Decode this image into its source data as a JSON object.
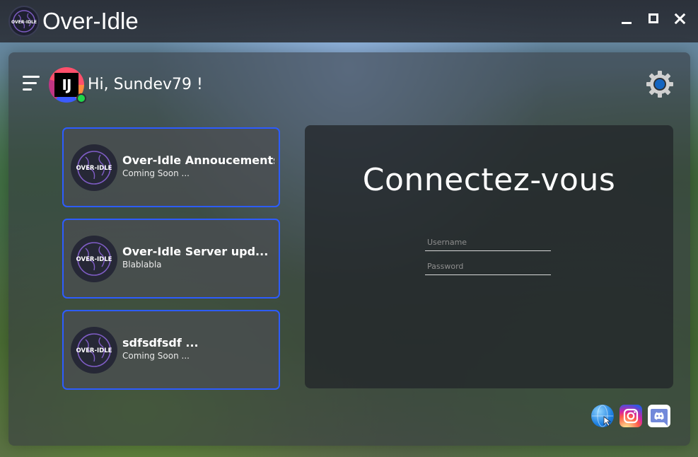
{
  "app": {
    "title": "Over-Idle",
    "logo_text": "OVER-IDLE"
  },
  "window_controls": {
    "minimize": "minimize",
    "maximize": "maximize",
    "close": "close"
  },
  "user": {
    "initials": "IJ",
    "greeting": "Hi, Sundev79 !",
    "status": "online"
  },
  "news": [
    {
      "title": "Over-Idle Annoucements",
      "subtitle": "Coming Soon ..."
    },
    {
      "title": "Over-Idle Server upd...",
      "subtitle": "Blablabla"
    },
    {
      "title": "sdfsdfsdf ...",
      "subtitle": "Coming Soon ..."
    }
  ],
  "login": {
    "title": "Connectez-vous",
    "username_placeholder": "Username",
    "password_placeholder": "Password",
    "username_value": "",
    "password_value": ""
  },
  "social": [
    "globe-icon",
    "instagram-icon",
    "discord-icon"
  ],
  "colors": {
    "accent": "#2d5cff",
    "status_online": "#1fd64a",
    "settings_accent": "#1565c0"
  }
}
